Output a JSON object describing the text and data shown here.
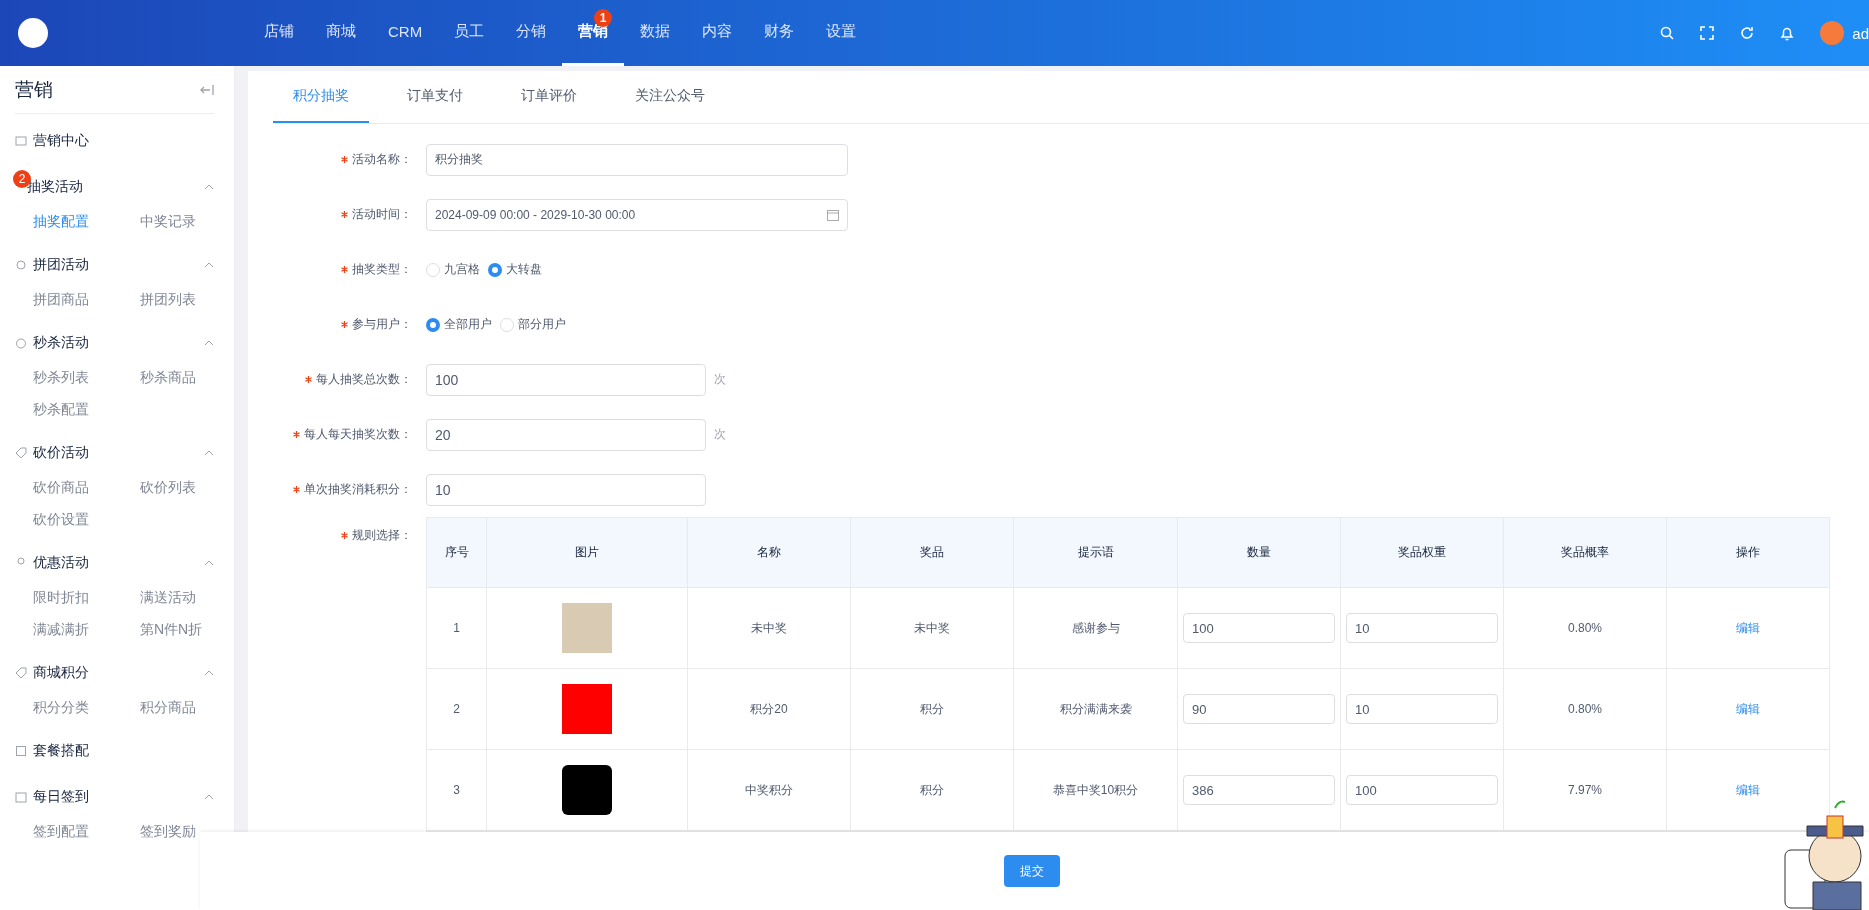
{
  "header": {
    "nav": [
      {
        "label": "店铺",
        "selected": false
      },
      {
        "label": "商城",
        "selected": false
      },
      {
        "label": "CRM",
        "selected": false
      },
      {
        "label": "员工",
        "selected": false
      },
      {
        "label": "分销",
        "selected": false
      },
      {
        "label": "营销",
        "selected": true,
        "badge": "1"
      },
      {
        "label": "数据",
        "selected": false
      },
      {
        "label": "内容",
        "selected": false
      },
      {
        "label": "财务",
        "selected": false
      },
      {
        "label": "设置",
        "selected": false
      }
    ],
    "user": "ad"
  },
  "sidebar": {
    "title": "营销",
    "items": [
      {
        "label": "营销中心"
      },
      {
        "label": "抽奖活动",
        "badge": "2",
        "expanded": true,
        "children": [
          {
            "label": "抽奖配置",
            "selected": true
          },
          {
            "label": "中奖记录",
            "selected": false
          }
        ]
      },
      {
        "label": "拼团活动",
        "expanded": true,
        "children": [
          {
            "label": "拼团商品",
            "selected": false
          },
          {
            "label": "拼团列表",
            "selected": false
          }
        ]
      },
      {
        "label": "秒杀活动",
        "expanded": true,
        "children": [
          {
            "label": "秒杀列表",
            "selected": false
          },
          {
            "label": "秒杀商品",
            "selected": false
          },
          {
            "label": "秒杀配置",
            "selected": false
          }
        ]
      },
      {
        "label": "砍价活动",
        "expanded": true,
        "children": [
          {
            "label": "砍价商品",
            "selected": false
          },
          {
            "label": "砍价列表",
            "selected": false
          },
          {
            "label": "砍价设置",
            "selected": false
          }
        ]
      },
      {
        "label": "优惠活动",
        "expanded": true,
        "children": [
          {
            "label": "限时折扣",
            "selected": false
          },
          {
            "label": "满送活动",
            "selected": false
          },
          {
            "label": "满减满折",
            "selected": false
          },
          {
            "label": "第N件N折",
            "selected": false
          }
        ]
      },
      {
        "label": "商城积分",
        "expanded": true,
        "children": [
          {
            "label": "积分分类",
            "selected": false
          },
          {
            "label": "积分商品",
            "selected": false
          }
        ]
      },
      {
        "label": "套餐搭配"
      },
      {
        "label": "每日签到",
        "expanded": true,
        "children": [
          {
            "label": "签到配置",
            "selected": false
          },
          {
            "label": "签到奖励",
            "selected": false
          }
        ]
      }
    ]
  },
  "tabs": [
    {
      "label": "积分抽奖",
      "selected": true
    },
    {
      "label": "订单支付",
      "selected": false
    },
    {
      "label": "订单评价",
      "selected": false
    },
    {
      "label": "关注公众号",
      "selected": false
    }
  ],
  "form": {
    "fields": [
      {
        "kind": "text",
        "label": "活动名称：",
        "required": true,
        "value": "积分抽奖"
      },
      {
        "kind": "date",
        "label": "活动时间：",
        "required": true,
        "value": "2024-09-09 00:00 - 2029-10-30 00:00"
      },
      {
        "kind": "radio",
        "label": "抽奖类型：",
        "required": true,
        "options": [
          {
            "label": "九宫格",
            "selected": false
          },
          {
            "label": "大转盘",
            "selected": true
          }
        ]
      },
      {
        "kind": "radio",
        "label": "参与用户：",
        "required": true,
        "options": [
          {
            "label": "全部用户",
            "selected": true
          },
          {
            "label": "部分用户",
            "selected": false
          }
        ]
      },
      {
        "kind": "number",
        "label": "每人抽奖总次数：",
        "required": true,
        "value": "100",
        "unit": "次"
      },
      {
        "kind": "number",
        "label": "每人每天抽奖次数：",
        "required": true,
        "value": "20",
        "unit": "次"
      },
      {
        "kind": "number",
        "label": "单次抽奖消耗积分：",
        "required": true,
        "value": "10"
      }
    ],
    "rules": {
      "label": "规则选择：",
      "required": true,
      "columns": [
        "序号",
        "图片",
        "名称",
        "奖品",
        "提示语",
        "数量",
        "奖品权重",
        "奖品概率",
        "操作"
      ],
      "rows": [
        {
          "index": "1",
          "kind": "photo",
          "name": "未中奖",
          "prize": "未中奖",
          "tip": "感谢参与",
          "quantity": "100",
          "weight": "10",
          "probability": "0.80%",
          "action": "编辑"
        },
        {
          "index": "2",
          "kind": "red-logo",
          "name": "积分20",
          "prize": "积分",
          "tip": "积分满满来袭",
          "quantity": "90",
          "weight": "10",
          "probability": "0.80%",
          "action": "编辑"
        },
        {
          "index": "3",
          "kind": "dark-logo",
          "name": "中奖积分",
          "prize": "积分",
          "tip": "恭喜中奖10积分",
          "quantity": "386",
          "weight": "100",
          "probability": "7.97%",
          "action": "编辑"
        }
      ]
    }
  },
  "footer": {
    "submit": "提交"
  }
}
